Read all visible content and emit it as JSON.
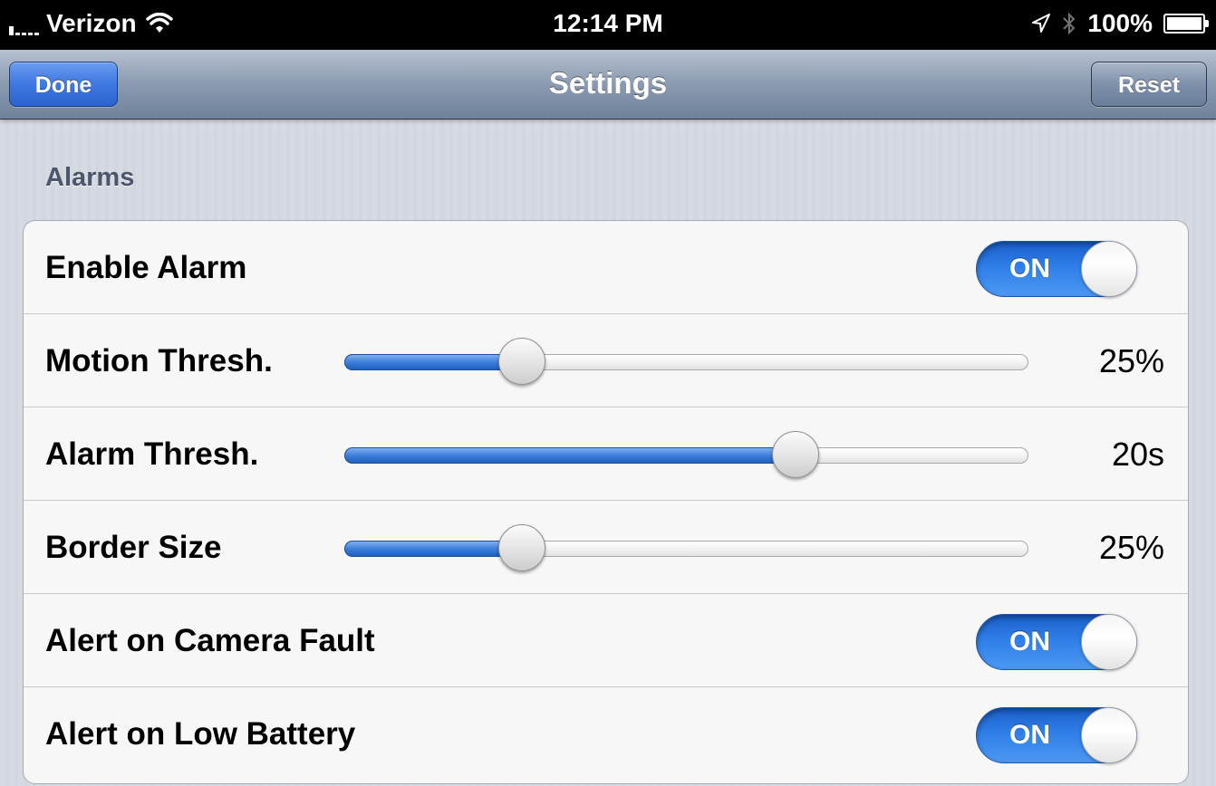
{
  "status_bar": {
    "carrier": "Verizon",
    "time": "12:14 PM",
    "battery": "100%",
    "signal_icon": "signal-bars-icon",
    "wifi_icon": "wifi-icon",
    "location_icon": "location-arrow-icon",
    "bluetooth_icon": "bluetooth-icon",
    "battery_icon": "battery-charging-icon"
  },
  "navbar": {
    "title": "Settings",
    "left_button": "Done",
    "right_button": "Reset"
  },
  "section": {
    "header": "Alarms",
    "rows": [
      {
        "type": "switch",
        "label": "Enable Alarm",
        "state": "ON"
      },
      {
        "type": "slider",
        "label": "Motion Thresh.",
        "value": "25%",
        "fraction": 0.26
      },
      {
        "type": "slider",
        "label": "Alarm Thresh.",
        "value": "20s",
        "fraction": 0.66
      },
      {
        "type": "slider",
        "label": "Border Size",
        "value": "25%",
        "fraction": 0.26
      },
      {
        "type": "switch",
        "label": "Alert on Camera Fault",
        "state": "ON"
      },
      {
        "type": "switch",
        "label": "Alert on Low Battery",
        "state": "ON"
      }
    ]
  },
  "colors": {
    "accent_blue": "#2f7ee8",
    "nav_bar": "#8b9ab0",
    "background": "#d6dbe3"
  }
}
